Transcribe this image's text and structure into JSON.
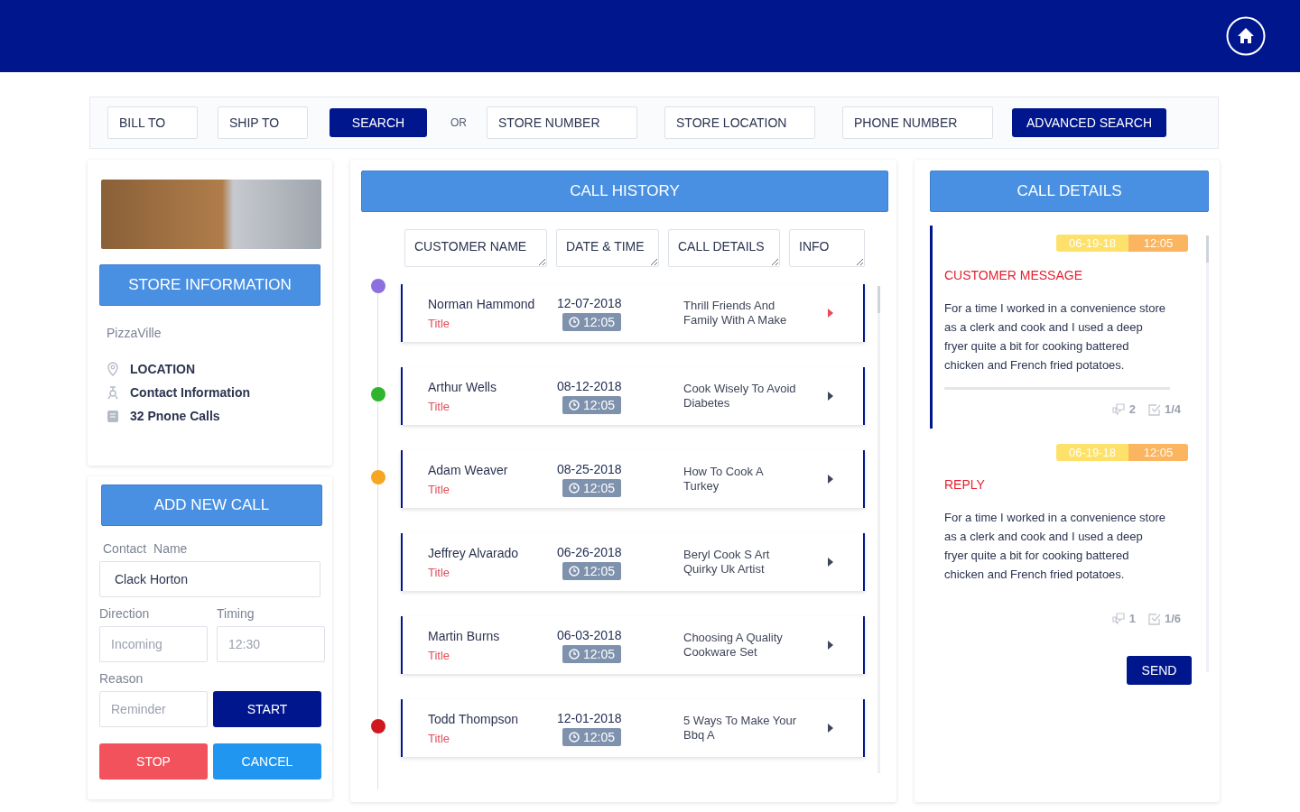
{
  "search_bar": {
    "fields_left": [
      {
        "placeholder": "BILL TO"
      },
      {
        "placeholder": "SHIP TO"
      }
    ],
    "search_button": "SEARCH",
    "or_label": "OR",
    "fields_right": [
      {
        "placeholder": "STORE NUMBER"
      },
      {
        "placeholder": "STORE LOCATION"
      },
      {
        "placeholder": "PHONE NUMBER"
      }
    ],
    "advanced_button": "ADVANCED SEARCH"
  },
  "store": {
    "button": "STORE INFORMATION",
    "name": "PizzaVille",
    "items": [
      {
        "kind": "location",
        "label": "LOCATION"
      },
      {
        "kind": "contact",
        "label": "Contact Information"
      },
      {
        "kind": "calls",
        "label": "32 Pnone Calls"
      }
    ]
  },
  "new_call": {
    "button": "ADD NEW CALL",
    "contact_label": "Contact  Name",
    "contact_value": "Clack Horton",
    "direction_label": "Direction",
    "direction_placeholder": "Incoming",
    "timing_label": "Timing",
    "timing_placeholder": "12:30",
    "reason_label": "Reason",
    "reason_placeholder": "Reminder",
    "start": "START",
    "stop": "STOP",
    "cancel": "CANCEL"
  },
  "call_history": {
    "title": "CALL HISTORY",
    "columns": [
      {
        "placeholder": "CUSTOMER NAME"
      },
      {
        "placeholder": "DATE & TIME"
      },
      {
        "placeholder": "CALL DETAILS"
      },
      {
        "placeholder": "INFO"
      }
    ],
    "calls": [
      {
        "name": "Norman Hammond",
        "title": "Title",
        "date": "12-07-2018",
        "time": "12:05",
        "details": "Thrill Friends And Family With A Make",
        "color": "#8e6fe0",
        "selected": true
      },
      {
        "name": "Arthur Wells",
        "title": "Title",
        "date": "08-12-2018",
        "time": "12:05",
        "details": "Cook Wisely To Avoid Diabetes",
        "color": "#2db52b",
        "selected": false
      },
      {
        "name": "Adam Weaver",
        "title": "Title",
        "date": "08-25-2018",
        "time": "12:05",
        "details": "How To Cook A Turkey",
        "color": "#f5a623",
        "selected": false
      },
      {
        "name": "Jeffrey Alvarado",
        "title": "Title",
        "date": "06-26-2018",
        "time": "12:05",
        "details": "Beryl Cook S Art Quirky Uk Artist",
        "selected": false
      },
      {
        "name": "Martin Burns",
        "title": "Title",
        "date": "06-03-2018",
        "time": "12:05",
        "details": "Choosing A Quality Cookware Set",
        "selected": false
      },
      {
        "name": "Todd Thompson",
        "title": "Title",
        "date": "12-01-2018",
        "time": "12:05",
        "details": "5 Ways To Make Your Bbq A",
        "color": "#d0191f",
        "selected": false
      }
    ]
  },
  "call_details": {
    "title": "CALL DETAILS",
    "messages": [
      {
        "date": "06-19-18",
        "time": "12:05",
        "heading": "CUSTOMER MESSAGE",
        "text": "For a time I worked in a convenience store as a clerk and cook and I used a deep fryer quite a bit for cooking battered chicken and French fried potatoes.",
        "comments": "2",
        "tasks": "1/4",
        "selected": true
      },
      {
        "date": "06-19-18",
        "time": "12:05",
        "heading": "REPLY",
        "text": "For a time I worked in a convenience store as a clerk and cook and I used a deep fryer quite a bit for cooking battered chicken and French fried potatoes.",
        "comments": "1",
        "tasks": "1/6",
        "selected": false
      }
    ],
    "send": "SEND"
  }
}
